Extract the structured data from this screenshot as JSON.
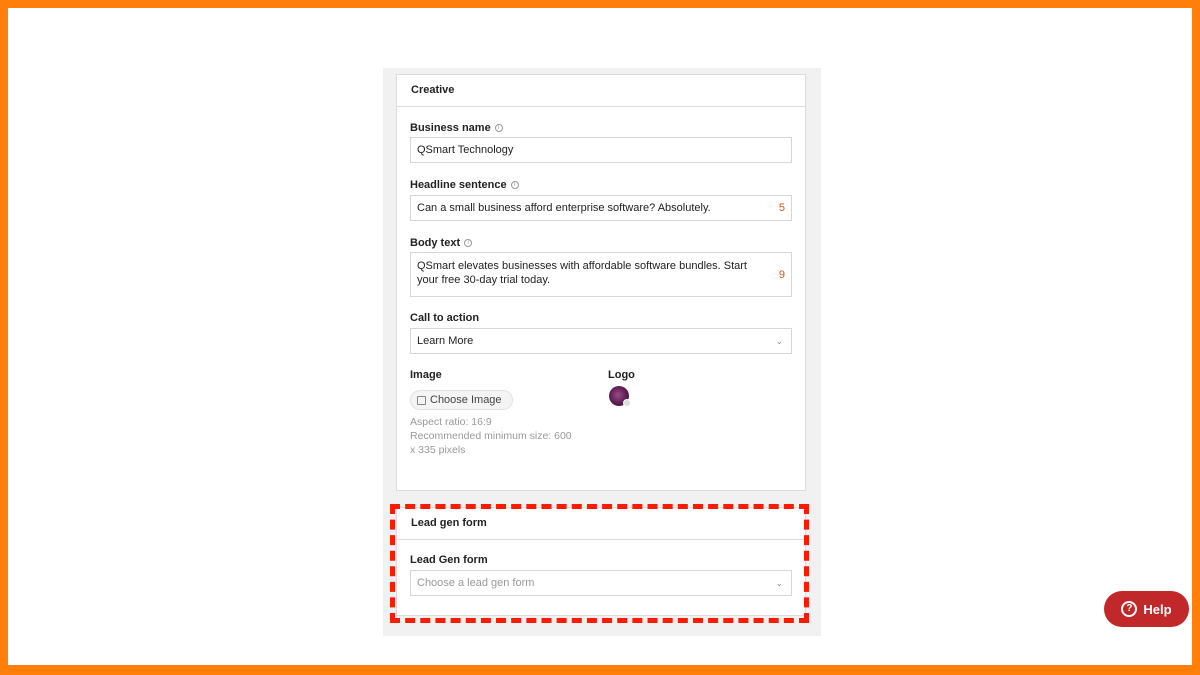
{
  "creative": {
    "title": "Creative",
    "business_name": {
      "label": "Business name",
      "value": "QSmart Technology"
    },
    "headline": {
      "label": "Headline sentence",
      "value": "Can a small business afford enterprise software? Absolutely.",
      "count": "5"
    },
    "body": {
      "label": "Body text",
      "value": "QSmart elevates businesses with affordable software bundles. Start your free 30-day trial today.",
      "count": "9"
    },
    "cta": {
      "label": "Call to action",
      "value": "Learn More"
    },
    "image": {
      "label": "Image",
      "button": "Choose Image",
      "hint1": "Aspect ratio: 16:9",
      "hint2": "Recommended minimum size: 600",
      "hint3": "x 335 pixels"
    },
    "logo": {
      "label": "Logo"
    }
  },
  "lead": {
    "title": "Lead gen form",
    "label": "Lead Gen form",
    "placeholder": "Choose a lead gen form"
  },
  "help": {
    "label": "Help"
  },
  "colors": {
    "frame": "#ff7f0a",
    "highlight": "#ff1a00",
    "help": "#c0282a",
    "counter": "#d2561f"
  }
}
